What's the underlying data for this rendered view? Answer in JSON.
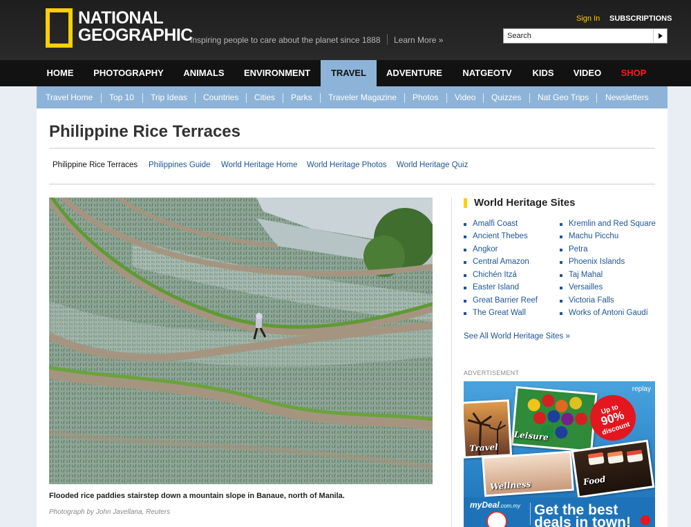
{
  "header": {
    "logo_text": "NATIONAL\nGEOGRAPHIC",
    "tagline": "Inspiring people to care about the planet since 1888",
    "learn_more": "Learn More »",
    "sign_in": "Sign In",
    "subscriptions": "SUBSCRIPTIONS",
    "search_placeholder": "Search"
  },
  "main_nav": [
    "HOME",
    "PHOTOGRAPHY",
    "ANIMALS",
    "ENVIRONMENT",
    "TRAVEL",
    "ADVENTURE",
    "NATGEOTV",
    "KIDS",
    "VIDEO",
    "SHOP"
  ],
  "active_nav": "TRAVEL",
  "sub_nav": [
    "Travel Home",
    "Top 10",
    "Trip Ideas",
    "Countries",
    "Cities",
    "Parks",
    "Traveler Magazine",
    "Photos",
    "Video",
    "Quizzes",
    "Nat Geo Trips",
    "Newsletters"
  ],
  "page": {
    "title": "Philippine Rice Terraces",
    "tabs": [
      "Philippine Rice Terraces",
      "Philippines Guide",
      "World Heritage Home",
      "World Heritage Photos",
      "World Heritage Quiz"
    ],
    "caption": "Flooded rice paddies stairstep down a mountain slope in Banaue, north of Manila.",
    "credit": "Photograph by John Javellana, Reuters"
  },
  "sidebar": {
    "heading": "World Heritage Sites",
    "col1": [
      "Amalfi Coast",
      "Ancient Thebes",
      "Angkor",
      "Central Amazon",
      "Chichén Itzá",
      "Easter Island",
      "Great Barrier Reef",
      "The Great Wall"
    ],
    "col2": [
      "Kremlin and Red Square",
      "Machu Picchu",
      "Petra",
      "Phoenix Islands",
      "Taj Mahal",
      "Versailles",
      "Victoria Falls",
      "Works of Antoni Gaudí"
    ],
    "see_all": "See All World Heritage Sites »",
    "ad_label": "ADVERTISEMENT"
  },
  "ad": {
    "replay": "replay",
    "badge_top": "Up to",
    "badge_big": "90%",
    "badge_bottom": "discount",
    "labels": [
      "Leisure",
      "Travel",
      "Wellness",
      "Food"
    ],
    "logo": "myDeal",
    "logo_suffix": ".com.my",
    "tagline": "Get the best deals in town!"
  },
  "colors": {
    "brand_yellow": "#ffcf00",
    "nav_active": "#8db4d8",
    "link": "#1d5496",
    "shop": "#ff1a1a"
  }
}
